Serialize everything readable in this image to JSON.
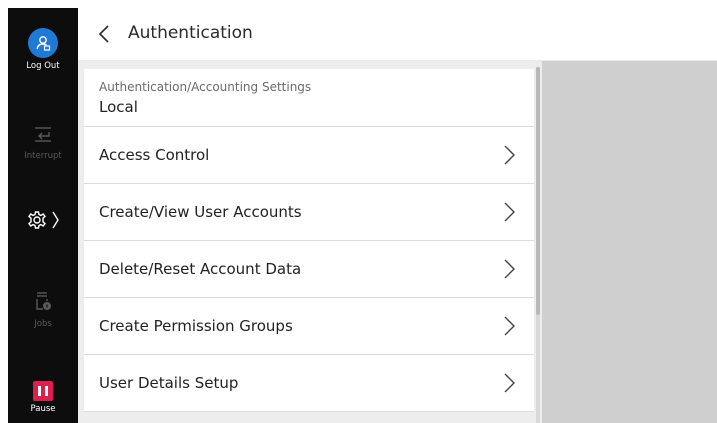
{
  "sidebar": {
    "logout_label": "Log Out",
    "interrupt_label": "Interrupt",
    "jobs_label": "Jobs",
    "pause_label": "Pause"
  },
  "header": {
    "title": "Authentication"
  },
  "list": {
    "summary": {
      "label": "Authentication/Accounting Settings",
      "value": "Local"
    },
    "items": [
      {
        "label": "Access Control"
      },
      {
        "label": "Create/View User Accounts"
      },
      {
        "label": "Delete/Reset Account Data"
      },
      {
        "label": "Create Permission Groups"
      },
      {
        "label": "User Details Setup"
      }
    ]
  },
  "colors": {
    "sidebar_bg": "#0d0d0d",
    "logout_accent": "#1f7ad6",
    "pause_accent": "#d9204f",
    "right_pane": "#cfcfcf"
  },
  "icons": {
    "logout": "user-logout-icon",
    "interrupt": "interrupt-icon",
    "settings": "gear-icon",
    "jobs": "jobs-icon",
    "pause": "pause-icon",
    "back": "chevron-left-icon",
    "row": "chevron-right-icon"
  }
}
